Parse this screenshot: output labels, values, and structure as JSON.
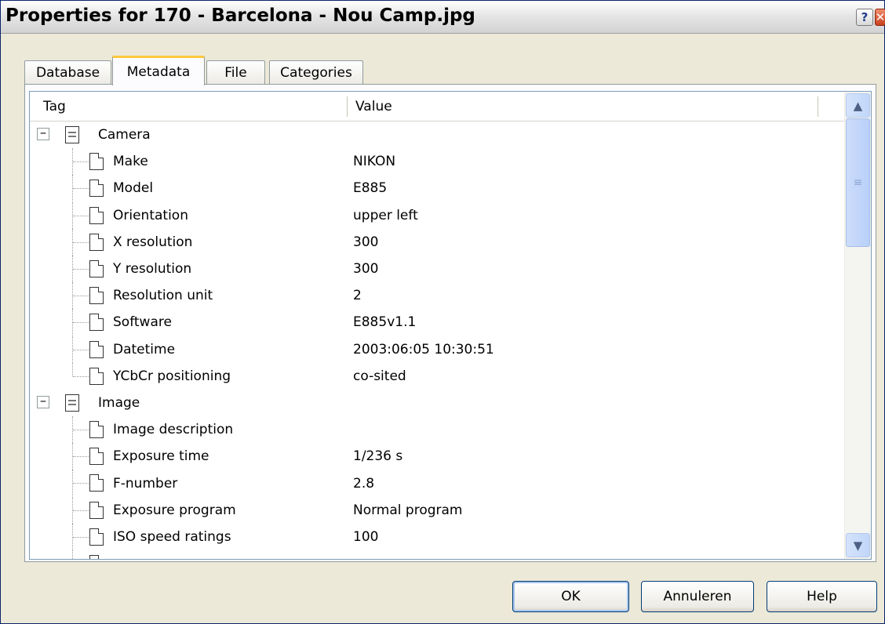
{
  "window": {
    "title": "Properties for 170 - Barcelona - Nou Camp.jpg",
    "help_caption": "?",
    "close_caption": "✕"
  },
  "tabs": [
    {
      "label": "Database"
    },
    {
      "label": "Metadata"
    },
    {
      "label": "File"
    },
    {
      "label": "Categories"
    }
  ],
  "table": {
    "col_tag": "Tag",
    "col_value": "Value",
    "groups": [
      {
        "label": "Camera",
        "expander": "−",
        "rows": [
          {
            "tag": "Make",
            "value": "NIKON"
          },
          {
            "tag": "Model",
            "value": "E885"
          },
          {
            "tag": "Orientation",
            "value": "upper left"
          },
          {
            "tag": "X resolution",
            "value": "300"
          },
          {
            "tag": "Y resolution",
            "value": "300"
          },
          {
            "tag": "Resolution unit",
            "value": "2"
          },
          {
            "tag": "Software",
            "value": "E885v1.1"
          },
          {
            "tag": "Datetime",
            "value": "2003:06:05 10:30:51"
          },
          {
            "tag": "YCbCr positioning",
            "value": "co-sited"
          }
        ]
      },
      {
        "label": "Image",
        "expander": "−",
        "rows": [
          {
            "tag": "Image description",
            "value": ""
          },
          {
            "tag": "Exposure time",
            "value": "1/236 s"
          },
          {
            "tag": "F-number",
            "value": "2.8"
          },
          {
            "tag": "Exposure program",
            "value": "Normal program"
          },
          {
            "tag": "ISO speed ratings",
            "value": "100"
          }
        ]
      }
    ]
  },
  "scrollbar": {
    "up_arrow": "▲",
    "down_arrow": "▼",
    "grip": "≡"
  },
  "buttons": {
    "ok": "OK",
    "cancel": "Annuleren",
    "help": "Help"
  }
}
